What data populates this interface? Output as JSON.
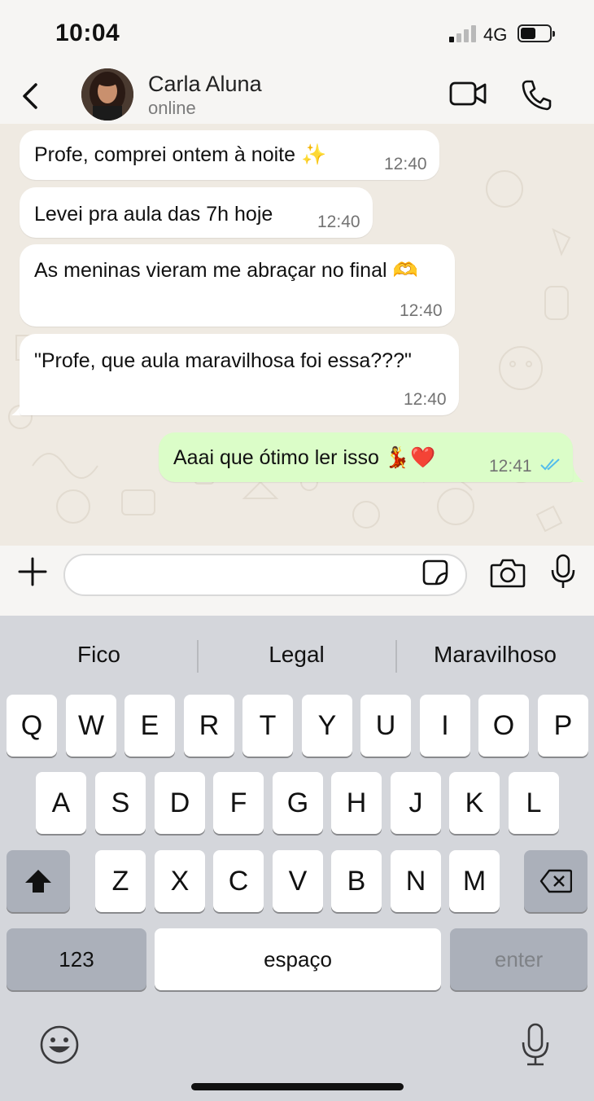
{
  "status_bar": {
    "time": "10:04",
    "network": "4G",
    "battery_level": 0.45,
    "signal_bars_active": 1,
    "signal_bars_total": 4
  },
  "header": {
    "contact_name": "Carla Aluna",
    "contact_status": "online"
  },
  "messages": [
    {
      "direction": "in",
      "text": "Profe, comprei ontem à noite ✨",
      "time": "12:40"
    },
    {
      "direction": "in",
      "text": "Levei pra aula das 7h hoje",
      "time": "12:40"
    },
    {
      "direction": "in",
      "text": "As meninas vieram me abraçar no final 🫶",
      "time": "12:40"
    },
    {
      "direction": "in",
      "text": "\"Profe, que aula maravilhosa foi essa???\"",
      "time": "12:40"
    },
    {
      "direction": "out",
      "text": "Aaai que ótimo ler isso 💃❤️",
      "time": "12:41",
      "status": "read"
    }
  ],
  "input": {
    "value": ""
  },
  "keyboard": {
    "suggestions": [
      "Fico",
      "Legal",
      "Maravilhoso"
    ],
    "row1": [
      "Q",
      "W",
      "E",
      "R",
      "T",
      "Y",
      "U",
      "I",
      "O",
      "P"
    ],
    "row2": [
      "A",
      "S",
      "D",
      "F",
      "G",
      "H",
      "J",
      "K",
      "L"
    ],
    "row3": [
      "Z",
      "X",
      "C",
      "V",
      "B",
      "N",
      "M"
    ],
    "numbers_label": "123",
    "space_label": "espaço",
    "enter_label": "enter"
  },
  "colors": {
    "chat_bg": "#efeae2",
    "outgoing_bubble": "#dbfdc8",
    "incoming_bubble": "#ffffff",
    "read_ticks": "#53bdeb"
  }
}
